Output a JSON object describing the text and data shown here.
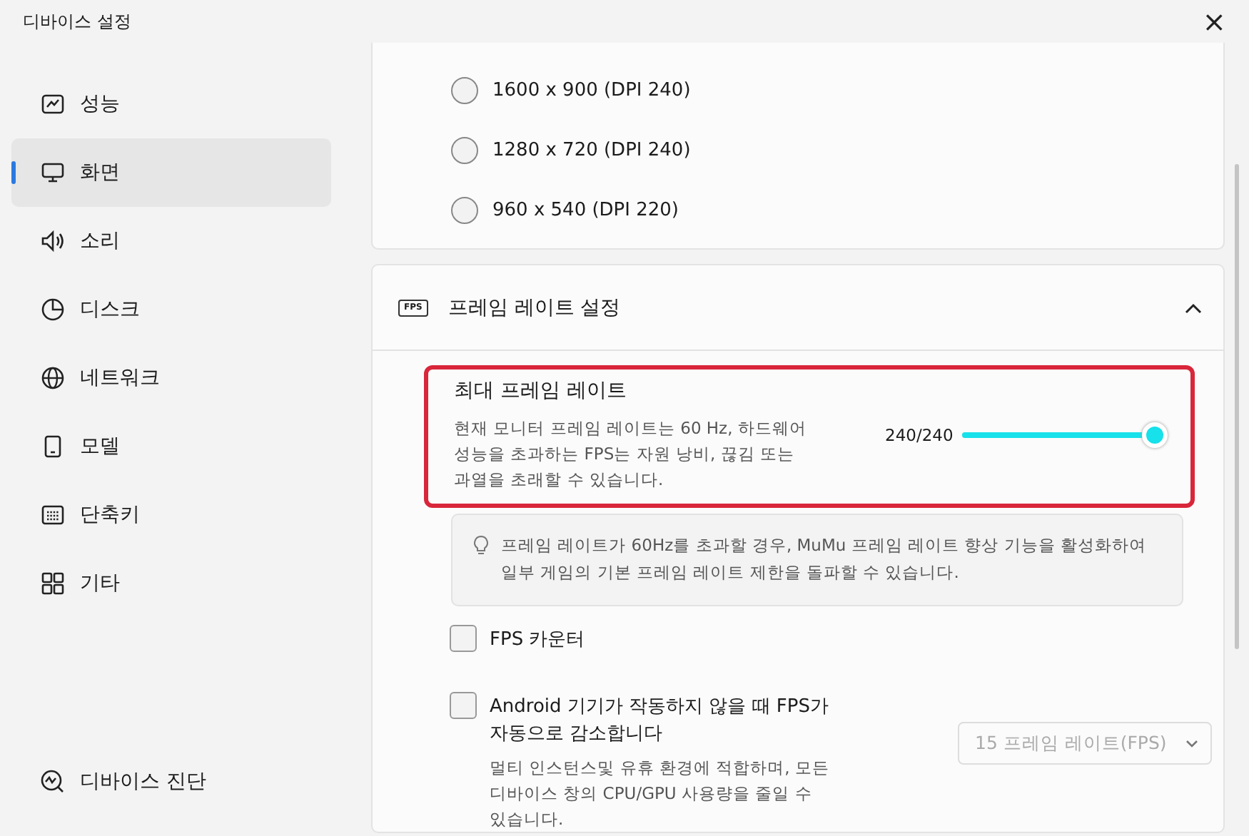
{
  "window": {
    "title": "디바이스 설정",
    "close": "×"
  },
  "sidebar": {
    "items": [
      {
        "label": "성능",
        "selected": false
      },
      {
        "label": "화면",
        "selected": true
      },
      {
        "label": "소리",
        "selected": false
      },
      {
        "label": "디스크",
        "selected": false
      },
      {
        "label": "네트워크",
        "selected": false
      },
      {
        "label": "모델",
        "selected": false
      },
      {
        "label": "단축키",
        "selected": false
      },
      {
        "label": "기타",
        "selected": false
      }
    ],
    "footer": {
      "label": "디바이스 진단"
    }
  },
  "resolution_options": [
    {
      "label": "1600 x 900 (DPI 240)",
      "selected": false
    },
    {
      "label": "1280 x 720 (DPI 240)",
      "selected": false
    },
    {
      "label": "960 x 540 (DPI 220)",
      "selected": false
    }
  ],
  "frame_rate_section": {
    "badge": "FPS",
    "title": "프레임 레이트 설정",
    "expanded": true,
    "max_frame_rate": {
      "title": "최대 프레임 레이트",
      "description": "현재 모니터 프레임 레이트는 60 Hz, 하드웨어 성능을 초과하는 FPS는 자원 낭비, 끊김 또는 과열을 초래할 수 있습니다.",
      "reading": "240/240",
      "level": 1,
      "highlighted": true
    },
    "tip": "프레임 레이트가 60Hz를 초과할 경우, MuMu 프레임 레이트 향상 기능을 활성화하여 일부 게임의 기본 프레임 레이트 제한을 돌파할 수 있습니다.",
    "fps_counter": {
      "label": "FPS 카운터",
      "checked": false
    },
    "auto_reduce": {
      "label": "Android 기기가 작동하지 않을 때 FPS가 자동으로 감소합니다",
      "checked": false,
      "description": "멀티 인스턴스및 유휴 환경에 적합하며, 모든 디바이스 창의 CPU/GPU 사용량을 줄일 수 있습니다.",
      "dropdown": {
        "value": "15 프레임 레이트(FPS)",
        "disabled": true
      }
    }
  }
}
